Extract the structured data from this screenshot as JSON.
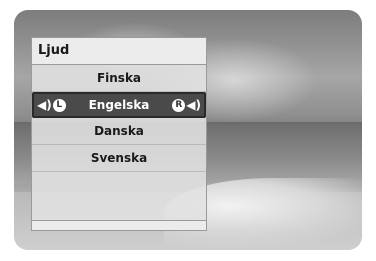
{
  "menu": {
    "title": "Ljud",
    "items": [
      {
        "label": "Finska"
      },
      {
        "label": "Engelska"
      },
      {
        "label": "Danska"
      },
      {
        "label": "Svenska"
      }
    ],
    "selected_index": 1,
    "left_channel_letter": "L",
    "right_channel_letter": "R"
  },
  "icons": {
    "left": [
      "speaker-left-icon",
      "channel-left-badge-icon"
    ],
    "right": [
      "channel-right-badge-icon",
      "speaker-right-icon"
    ]
  },
  "colors": {
    "selected_bg": "#4a4a4a",
    "panel_bg": "#e1e1e1",
    "text": "#1a1a1a"
  }
}
